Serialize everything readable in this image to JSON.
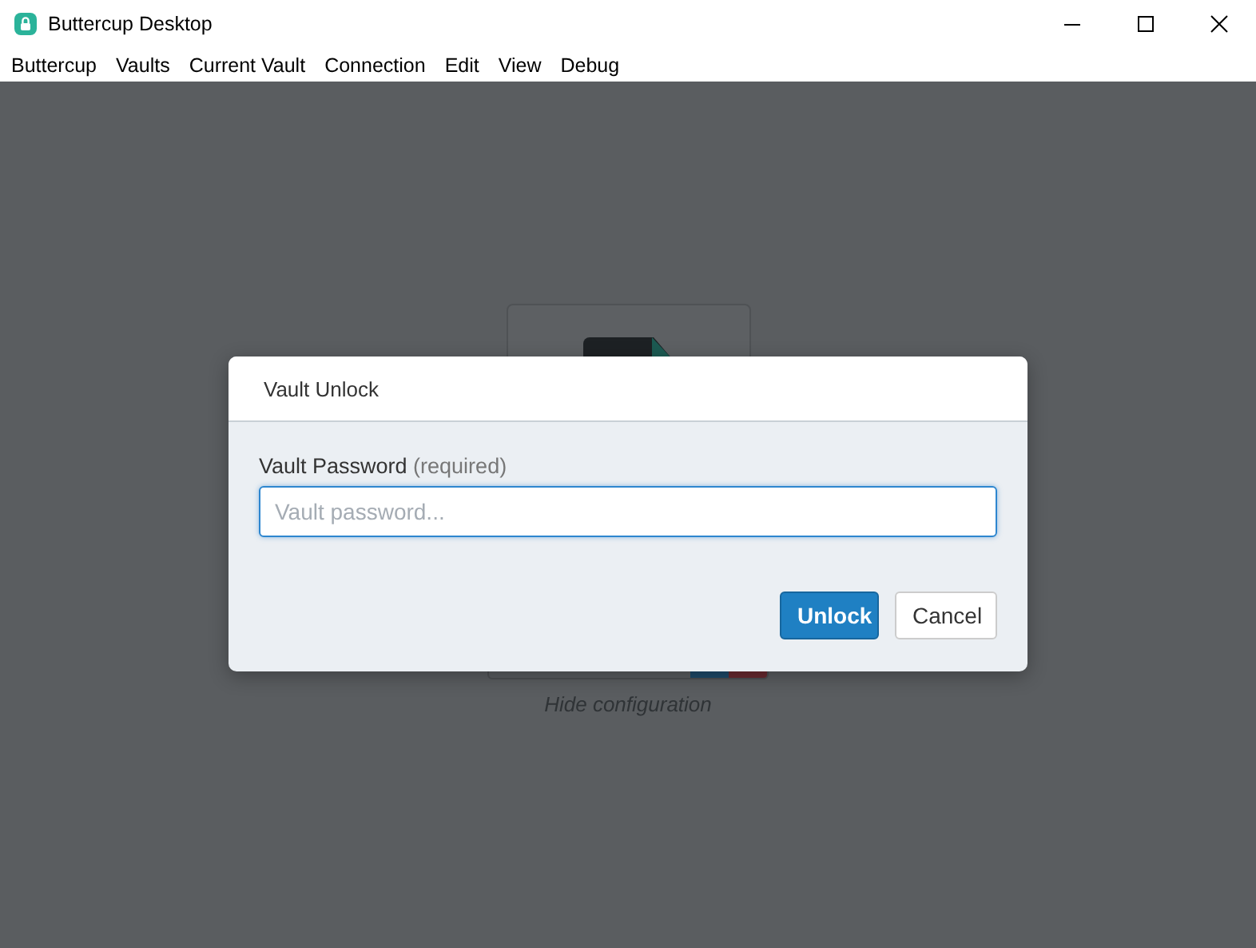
{
  "window": {
    "title": "Buttercup Desktop"
  },
  "menu": [
    "Buttercup",
    "Vaults",
    "Current Vault",
    "Connection",
    "Edit",
    "View",
    "Debug"
  ],
  "background": {
    "link": "Hide configuration"
  },
  "dialog": {
    "title": "Vault Unlock",
    "label": "Vault Password",
    "label_hint": "(required)",
    "password": {
      "placeholder": "Vault password..."
    },
    "buttons": [
      {
        "label": "Unlock",
        "kind": "primary"
      },
      {
        "label": "Cancel",
        "kind": "secondary"
      }
    ]
  }
}
